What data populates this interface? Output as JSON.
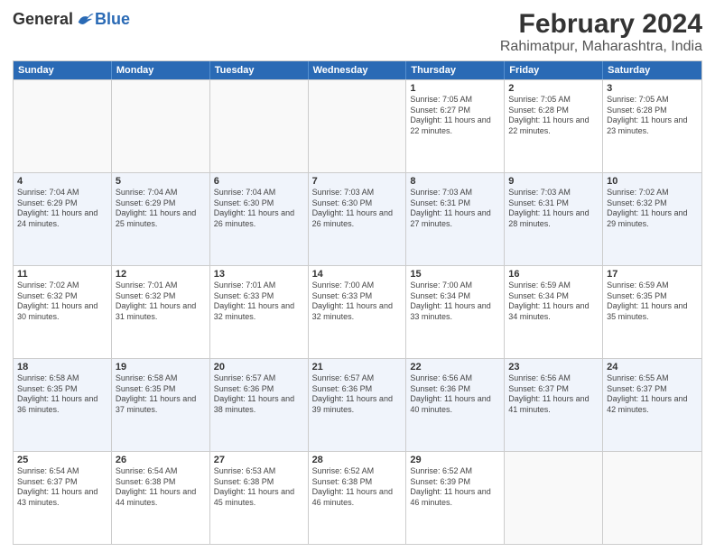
{
  "logo": {
    "general": "General",
    "blue": "Blue"
  },
  "title": "February 2024",
  "subtitle": "Rahimatpur, Maharashtra, India",
  "days": [
    "Sunday",
    "Monday",
    "Tuesday",
    "Wednesday",
    "Thursday",
    "Friday",
    "Saturday"
  ],
  "weeks": [
    [
      {
        "date": "",
        "sunrise": "",
        "sunset": "",
        "daylight": "",
        "empty": true
      },
      {
        "date": "",
        "sunrise": "",
        "sunset": "",
        "daylight": "",
        "empty": true
      },
      {
        "date": "",
        "sunrise": "",
        "sunset": "",
        "daylight": "",
        "empty": true
      },
      {
        "date": "",
        "sunrise": "",
        "sunset": "",
        "daylight": "",
        "empty": true
      },
      {
        "date": "1",
        "sunrise": "Sunrise: 7:05 AM",
        "sunset": "Sunset: 6:27 PM",
        "daylight": "Daylight: 11 hours and 22 minutes.",
        "empty": false
      },
      {
        "date": "2",
        "sunrise": "Sunrise: 7:05 AM",
        "sunset": "Sunset: 6:28 PM",
        "daylight": "Daylight: 11 hours and 22 minutes.",
        "empty": false
      },
      {
        "date": "3",
        "sunrise": "Sunrise: 7:05 AM",
        "sunset": "Sunset: 6:28 PM",
        "daylight": "Daylight: 11 hours and 23 minutes.",
        "empty": false
      }
    ],
    [
      {
        "date": "4",
        "sunrise": "Sunrise: 7:04 AM",
        "sunset": "Sunset: 6:29 PM",
        "daylight": "Daylight: 11 hours and 24 minutes.",
        "empty": false
      },
      {
        "date": "5",
        "sunrise": "Sunrise: 7:04 AM",
        "sunset": "Sunset: 6:29 PM",
        "daylight": "Daylight: 11 hours and 25 minutes.",
        "empty": false
      },
      {
        "date": "6",
        "sunrise": "Sunrise: 7:04 AM",
        "sunset": "Sunset: 6:30 PM",
        "daylight": "Daylight: 11 hours and 26 minutes.",
        "empty": false
      },
      {
        "date": "7",
        "sunrise": "Sunrise: 7:03 AM",
        "sunset": "Sunset: 6:30 PM",
        "daylight": "Daylight: 11 hours and 26 minutes.",
        "empty": false
      },
      {
        "date": "8",
        "sunrise": "Sunrise: 7:03 AM",
        "sunset": "Sunset: 6:31 PM",
        "daylight": "Daylight: 11 hours and 27 minutes.",
        "empty": false
      },
      {
        "date": "9",
        "sunrise": "Sunrise: 7:03 AM",
        "sunset": "Sunset: 6:31 PM",
        "daylight": "Daylight: 11 hours and 28 minutes.",
        "empty": false
      },
      {
        "date": "10",
        "sunrise": "Sunrise: 7:02 AM",
        "sunset": "Sunset: 6:32 PM",
        "daylight": "Daylight: 11 hours and 29 minutes.",
        "empty": false
      }
    ],
    [
      {
        "date": "11",
        "sunrise": "Sunrise: 7:02 AM",
        "sunset": "Sunset: 6:32 PM",
        "daylight": "Daylight: 11 hours and 30 minutes.",
        "empty": false
      },
      {
        "date": "12",
        "sunrise": "Sunrise: 7:01 AM",
        "sunset": "Sunset: 6:32 PM",
        "daylight": "Daylight: 11 hours and 31 minutes.",
        "empty": false
      },
      {
        "date": "13",
        "sunrise": "Sunrise: 7:01 AM",
        "sunset": "Sunset: 6:33 PM",
        "daylight": "Daylight: 11 hours and 32 minutes.",
        "empty": false
      },
      {
        "date": "14",
        "sunrise": "Sunrise: 7:00 AM",
        "sunset": "Sunset: 6:33 PM",
        "daylight": "Daylight: 11 hours and 32 minutes.",
        "empty": false
      },
      {
        "date": "15",
        "sunrise": "Sunrise: 7:00 AM",
        "sunset": "Sunset: 6:34 PM",
        "daylight": "Daylight: 11 hours and 33 minutes.",
        "empty": false
      },
      {
        "date": "16",
        "sunrise": "Sunrise: 6:59 AM",
        "sunset": "Sunset: 6:34 PM",
        "daylight": "Daylight: 11 hours and 34 minutes.",
        "empty": false
      },
      {
        "date": "17",
        "sunrise": "Sunrise: 6:59 AM",
        "sunset": "Sunset: 6:35 PM",
        "daylight": "Daylight: 11 hours and 35 minutes.",
        "empty": false
      }
    ],
    [
      {
        "date": "18",
        "sunrise": "Sunrise: 6:58 AM",
        "sunset": "Sunset: 6:35 PM",
        "daylight": "Daylight: 11 hours and 36 minutes.",
        "empty": false
      },
      {
        "date": "19",
        "sunrise": "Sunrise: 6:58 AM",
        "sunset": "Sunset: 6:35 PM",
        "daylight": "Daylight: 11 hours and 37 minutes.",
        "empty": false
      },
      {
        "date": "20",
        "sunrise": "Sunrise: 6:57 AM",
        "sunset": "Sunset: 6:36 PM",
        "daylight": "Daylight: 11 hours and 38 minutes.",
        "empty": false
      },
      {
        "date": "21",
        "sunrise": "Sunrise: 6:57 AM",
        "sunset": "Sunset: 6:36 PM",
        "daylight": "Daylight: 11 hours and 39 minutes.",
        "empty": false
      },
      {
        "date": "22",
        "sunrise": "Sunrise: 6:56 AM",
        "sunset": "Sunset: 6:36 PM",
        "daylight": "Daylight: 11 hours and 40 minutes.",
        "empty": false
      },
      {
        "date": "23",
        "sunrise": "Sunrise: 6:56 AM",
        "sunset": "Sunset: 6:37 PM",
        "daylight": "Daylight: 11 hours and 41 minutes.",
        "empty": false
      },
      {
        "date": "24",
        "sunrise": "Sunrise: 6:55 AM",
        "sunset": "Sunset: 6:37 PM",
        "daylight": "Daylight: 11 hours and 42 minutes.",
        "empty": false
      }
    ],
    [
      {
        "date": "25",
        "sunrise": "Sunrise: 6:54 AM",
        "sunset": "Sunset: 6:37 PM",
        "daylight": "Daylight: 11 hours and 43 minutes.",
        "empty": false
      },
      {
        "date": "26",
        "sunrise": "Sunrise: 6:54 AM",
        "sunset": "Sunset: 6:38 PM",
        "daylight": "Daylight: 11 hours and 44 minutes.",
        "empty": false
      },
      {
        "date": "27",
        "sunrise": "Sunrise: 6:53 AM",
        "sunset": "Sunset: 6:38 PM",
        "daylight": "Daylight: 11 hours and 45 minutes.",
        "empty": false
      },
      {
        "date": "28",
        "sunrise": "Sunrise: 6:52 AM",
        "sunset": "Sunset: 6:38 PM",
        "daylight": "Daylight: 11 hours and 46 minutes.",
        "empty": false
      },
      {
        "date": "29",
        "sunrise": "Sunrise: 6:52 AM",
        "sunset": "Sunset: 6:39 PM",
        "daylight": "Daylight: 11 hours and 46 minutes.",
        "empty": false
      },
      {
        "date": "",
        "sunrise": "",
        "sunset": "",
        "daylight": "",
        "empty": true
      },
      {
        "date": "",
        "sunrise": "",
        "sunset": "",
        "daylight": "",
        "empty": true
      }
    ]
  ]
}
